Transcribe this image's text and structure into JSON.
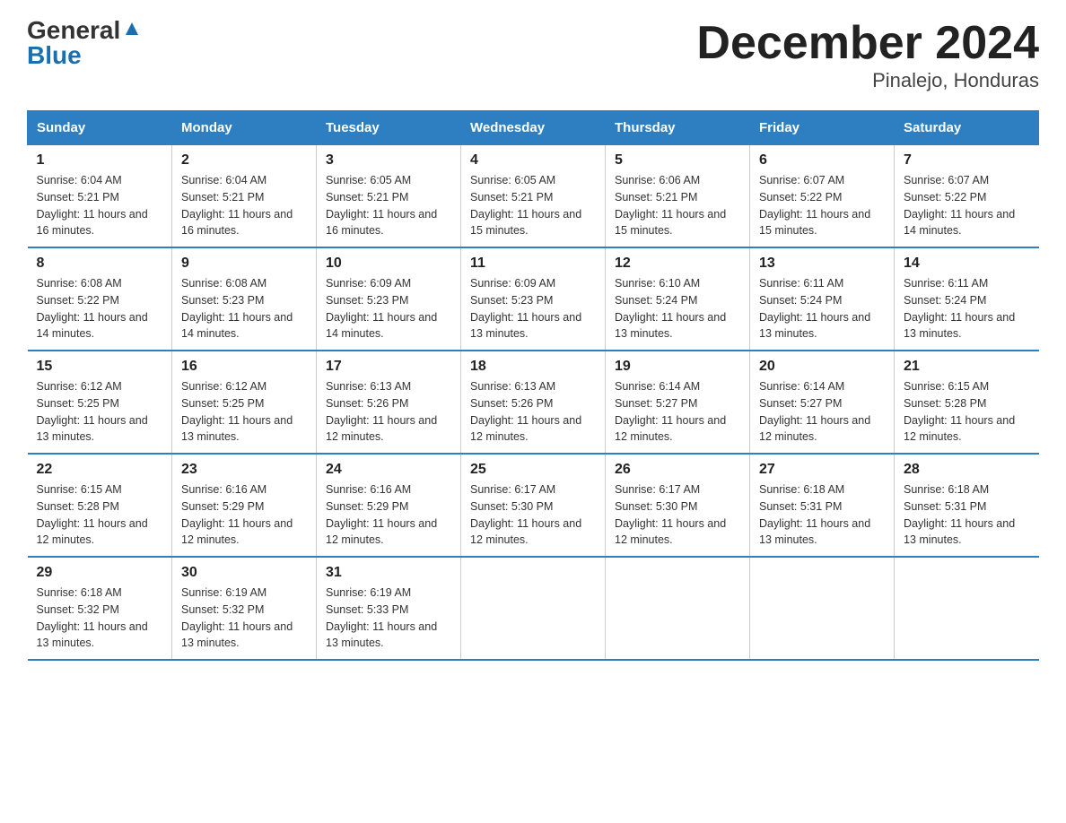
{
  "logo": {
    "general": "General",
    "blue": "Blue"
  },
  "title": "December 2024",
  "subtitle": "Pinalejo, Honduras",
  "days_of_week": [
    "Sunday",
    "Monday",
    "Tuesday",
    "Wednesday",
    "Thursday",
    "Friday",
    "Saturday"
  ],
  "weeks": [
    [
      {
        "day": "1",
        "sunrise": "6:04 AM",
        "sunset": "5:21 PM",
        "daylight": "11 hours and 16 minutes."
      },
      {
        "day": "2",
        "sunrise": "6:04 AM",
        "sunset": "5:21 PM",
        "daylight": "11 hours and 16 minutes."
      },
      {
        "day": "3",
        "sunrise": "6:05 AM",
        "sunset": "5:21 PM",
        "daylight": "11 hours and 16 minutes."
      },
      {
        "day": "4",
        "sunrise": "6:05 AM",
        "sunset": "5:21 PM",
        "daylight": "11 hours and 15 minutes."
      },
      {
        "day": "5",
        "sunrise": "6:06 AM",
        "sunset": "5:21 PM",
        "daylight": "11 hours and 15 minutes."
      },
      {
        "day": "6",
        "sunrise": "6:07 AM",
        "sunset": "5:22 PM",
        "daylight": "11 hours and 15 minutes."
      },
      {
        "day": "7",
        "sunrise": "6:07 AM",
        "sunset": "5:22 PM",
        "daylight": "11 hours and 14 minutes."
      }
    ],
    [
      {
        "day": "8",
        "sunrise": "6:08 AM",
        "sunset": "5:22 PM",
        "daylight": "11 hours and 14 minutes."
      },
      {
        "day": "9",
        "sunrise": "6:08 AM",
        "sunset": "5:23 PM",
        "daylight": "11 hours and 14 minutes."
      },
      {
        "day": "10",
        "sunrise": "6:09 AM",
        "sunset": "5:23 PM",
        "daylight": "11 hours and 14 minutes."
      },
      {
        "day": "11",
        "sunrise": "6:09 AM",
        "sunset": "5:23 PM",
        "daylight": "11 hours and 13 minutes."
      },
      {
        "day": "12",
        "sunrise": "6:10 AM",
        "sunset": "5:24 PM",
        "daylight": "11 hours and 13 minutes."
      },
      {
        "day": "13",
        "sunrise": "6:11 AM",
        "sunset": "5:24 PM",
        "daylight": "11 hours and 13 minutes."
      },
      {
        "day": "14",
        "sunrise": "6:11 AM",
        "sunset": "5:24 PM",
        "daylight": "11 hours and 13 minutes."
      }
    ],
    [
      {
        "day": "15",
        "sunrise": "6:12 AM",
        "sunset": "5:25 PM",
        "daylight": "11 hours and 13 minutes."
      },
      {
        "day": "16",
        "sunrise": "6:12 AM",
        "sunset": "5:25 PM",
        "daylight": "11 hours and 13 minutes."
      },
      {
        "day": "17",
        "sunrise": "6:13 AM",
        "sunset": "5:26 PM",
        "daylight": "11 hours and 12 minutes."
      },
      {
        "day": "18",
        "sunrise": "6:13 AM",
        "sunset": "5:26 PM",
        "daylight": "11 hours and 12 minutes."
      },
      {
        "day": "19",
        "sunrise": "6:14 AM",
        "sunset": "5:27 PM",
        "daylight": "11 hours and 12 minutes."
      },
      {
        "day": "20",
        "sunrise": "6:14 AM",
        "sunset": "5:27 PM",
        "daylight": "11 hours and 12 minutes."
      },
      {
        "day": "21",
        "sunrise": "6:15 AM",
        "sunset": "5:28 PM",
        "daylight": "11 hours and 12 minutes."
      }
    ],
    [
      {
        "day": "22",
        "sunrise": "6:15 AM",
        "sunset": "5:28 PM",
        "daylight": "11 hours and 12 minutes."
      },
      {
        "day": "23",
        "sunrise": "6:16 AM",
        "sunset": "5:29 PM",
        "daylight": "11 hours and 12 minutes."
      },
      {
        "day": "24",
        "sunrise": "6:16 AM",
        "sunset": "5:29 PM",
        "daylight": "11 hours and 12 minutes."
      },
      {
        "day": "25",
        "sunrise": "6:17 AM",
        "sunset": "5:30 PM",
        "daylight": "11 hours and 12 minutes."
      },
      {
        "day": "26",
        "sunrise": "6:17 AM",
        "sunset": "5:30 PM",
        "daylight": "11 hours and 12 minutes."
      },
      {
        "day": "27",
        "sunrise": "6:18 AM",
        "sunset": "5:31 PM",
        "daylight": "11 hours and 13 minutes."
      },
      {
        "day": "28",
        "sunrise": "6:18 AM",
        "sunset": "5:31 PM",
        "daylight": "11 hours and 13 minutes."
      }
    ],
    [
      {
        "day": "29",
        "sunrise": "6:18 AM",
        "sunset": "5:32 PM",
        "daylight": "11 hours and 13 minutes."
      },
      {
        "day": "30",
        "sunrise": "6:19 AM",
        "sunset": "5:32 PM",
        "daylight": "11 hours and 13 minutes."
      },
      {
        "day": "31",
        "sunrise": "6:19 AM",
        "sunset": "5:33 PM",
        "daylight": "11 hours and 13 minutes."
      },
      null,
      null,
      null,
      null
    ]
  ]
}
